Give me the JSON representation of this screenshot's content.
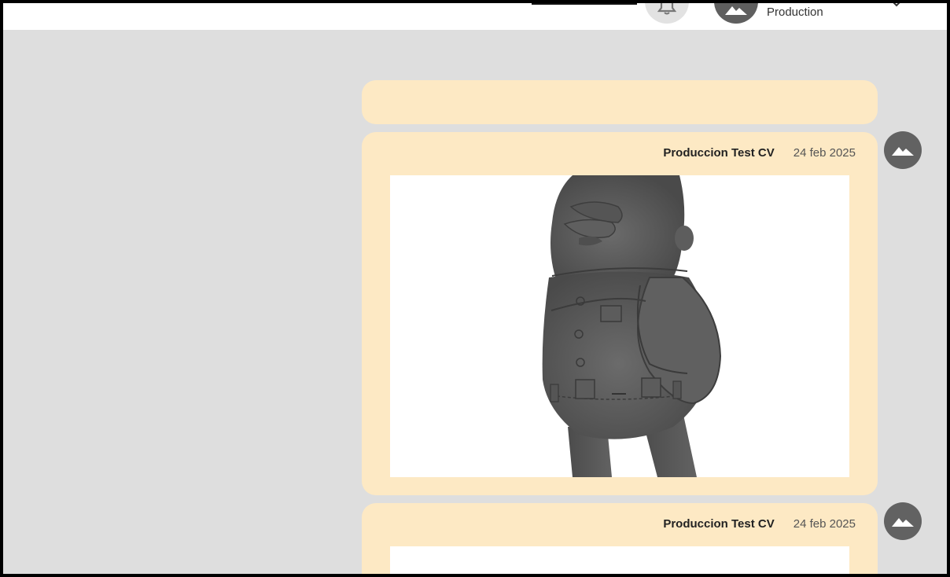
{
  "header": {
    "user_role": "Production",
    "bell_icon": "bell-icon",
    "avatar_icon": "mountain-icon",
    "chevron_icon": "chevron-down-icon"
  },
  "messages": [
    {
      "author": "Produccion Test CV",
      "date": "24 feb 2025",
      "avatar_icon": "mountain-icon",
      "media_type": "3d-render-image"
    },
    {
      "author": "Produccion Test CV",
      "date": "24 feb 2025",
      "avatar_icon": "mountain-icon",
      "media_type": "image"
    }
  ],
  "colors": {
    "background": "#dedede",
    "card": "#fde9c4",
    "avatar": "#626262",
    "render": "#5a5a5a"
  }
}
